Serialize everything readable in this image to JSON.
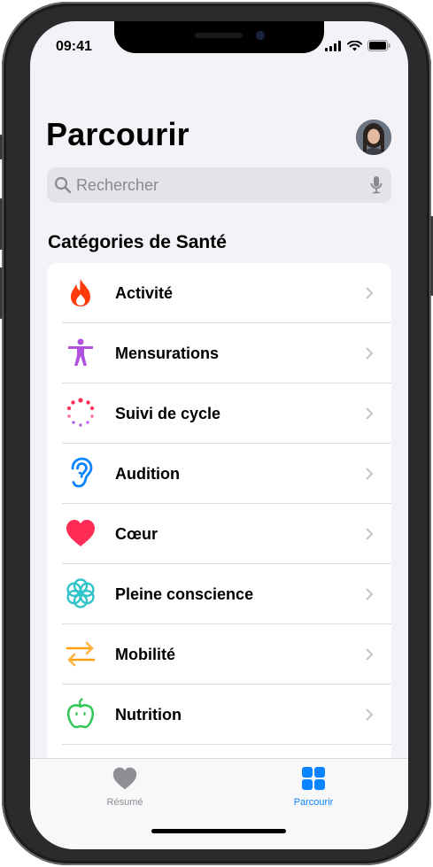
{
  "status": {
    "time": "09:41"
  },
  "header": {
    "title": "Parcourir"
  },
  "search": {
    "placeholder": "Rechercher"
  },
  "section": {
    "title": "Catégories de Santé"
  },
  "categories": [
    {
      "label": "Activité",
      "icon": "flame-icon",
      "color": "#ff3b0a"
    },
    {
      "label": "Mensurations",
      "icon": "person-figure-icon",
      "color": "#af52de"
    },
    {
      "label": "Suivi de cycle",
      "icon": "cycle-dots-icon",
      "color": "#ff2d55"
    },
    {
      "label": "Audition",
      "icon": "ear-icon",
      "color": "#0a84ff"
    },
    {
      "label": "Cœur",
      "icon": "heart-icon",
      "color": "#ff2d55"
    },
    {
      "label": "Pleine conscience",
      "icon": "flower-icon",
      "color": "#30c3c9"
    },
    {
      "label": "Mobilité",
      "icon": "arrows-icon",
      "color": "#ff9f0a"
    },
    {
      "label": "Nutrition",
      "icon": "apple-icon",
      "color": "#34c759"
    }
  ],
  "tabs": [
    {
      "label": "Résumé",
      "icon": "heart-icon",
      "active": false
    },
    {
      "label": "Parcourir",
      "icon": "grid-icon",
      "active": true
    }
  ],
  "colors": {
    "accent": "#0a84ff",
    "inactive": "#8e8e93"
  }
}
